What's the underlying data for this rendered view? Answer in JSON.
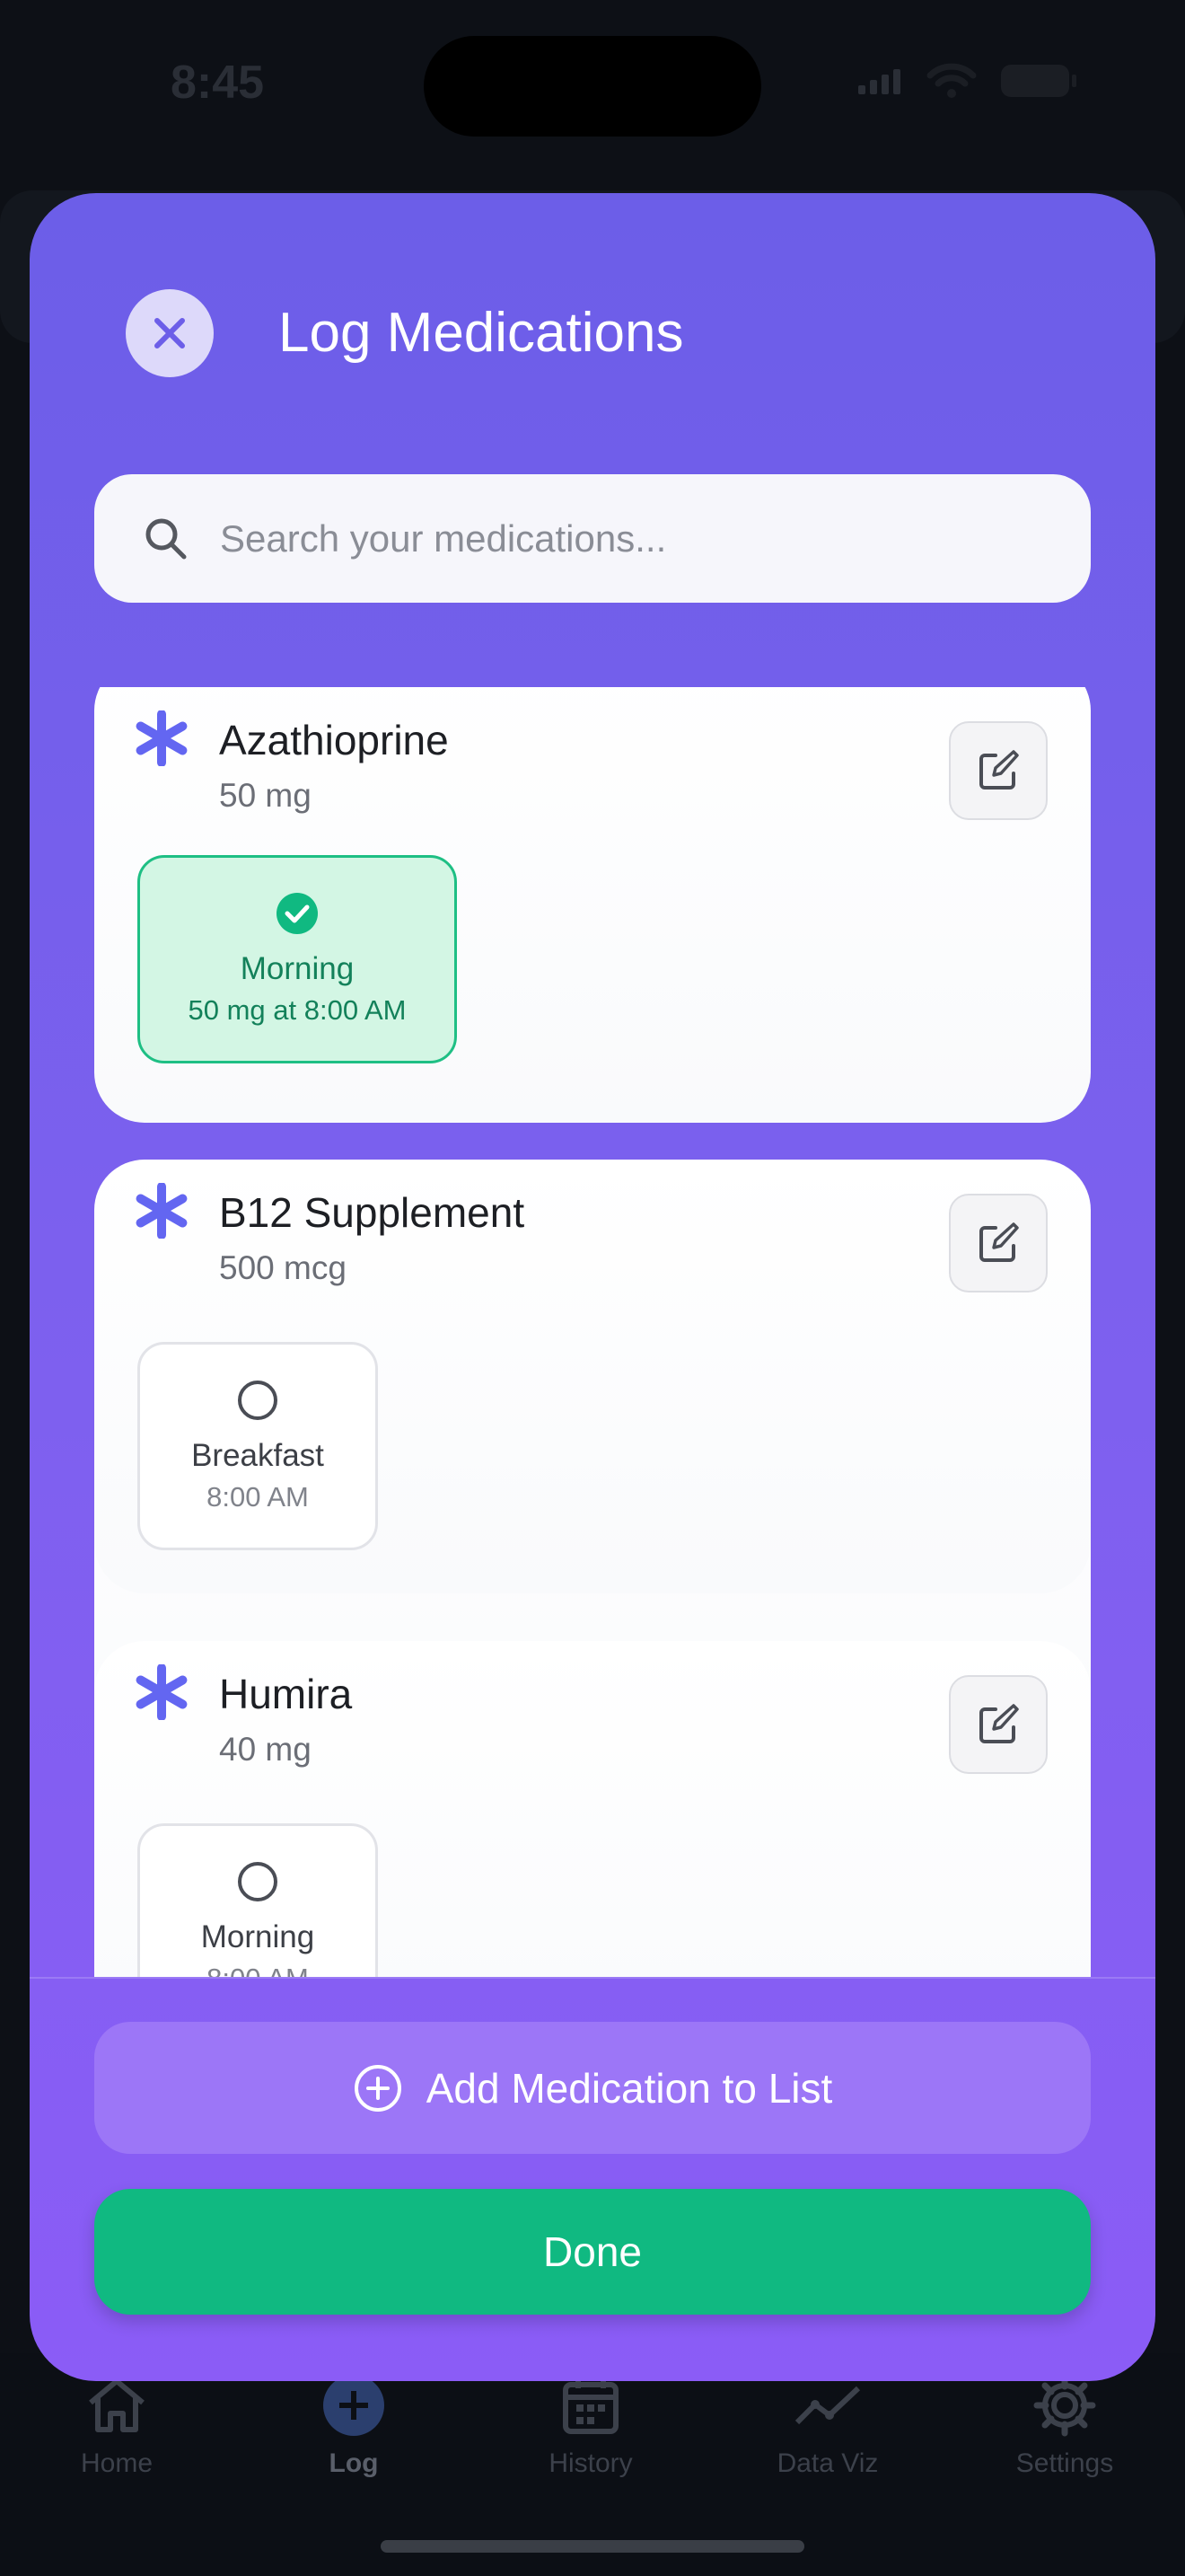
{
  "status_bar": {
    "time": "8:45"
  },
  "modal": {
    "title": "Log Medications",
    "search_placeholder": "Search your medications...",
    "medications": [
      {
        "name": "Azathioprine",
        "dose": "50 mg",
        "doses": [
          {
            "label": "Morning",
            "sub": "50 mg at 8:00 AM",
            "taken": true
          }
        ]
      },
      {
        "name": "B12 Supplement",
        "dose": "500 mcg",
        "doses": [
          {
            "label": "Breakfast",
            "sub": "8:00 AM",
            "taken": false
          }
        ]
      },
      {
        "name": "Humira",
        "dose": "40 mg",
        "doses": [
          {
            "label": "Morning",
            "sub": "8:00 AM",
            "taken": false
          }
        ]
      }
    ],
    "add_button": "Add Medication to List",
    "done_button": "Done"
  },
  "tab_bar": {
    "tabs": [
      {
        "label": "Home",
        "icon": "home-icon"
      },
      {
        "label": "Log",
        "icon": "plus-circle-icon",
        "active": true
      },
      {
        "label": "History",
        "icon": "calendar-icon"
      },
      {
        "label": "Data Viz",
        "icon": "chart-line-icon"
      },
      {
        "label": "Settings",
        "icon": "gear-icon"
      }
    ]
  },
  "colors": {
    "accent": "#6c5ee8",
    "success": "#10b981",
    "background": "#0d1016"
  }
}
